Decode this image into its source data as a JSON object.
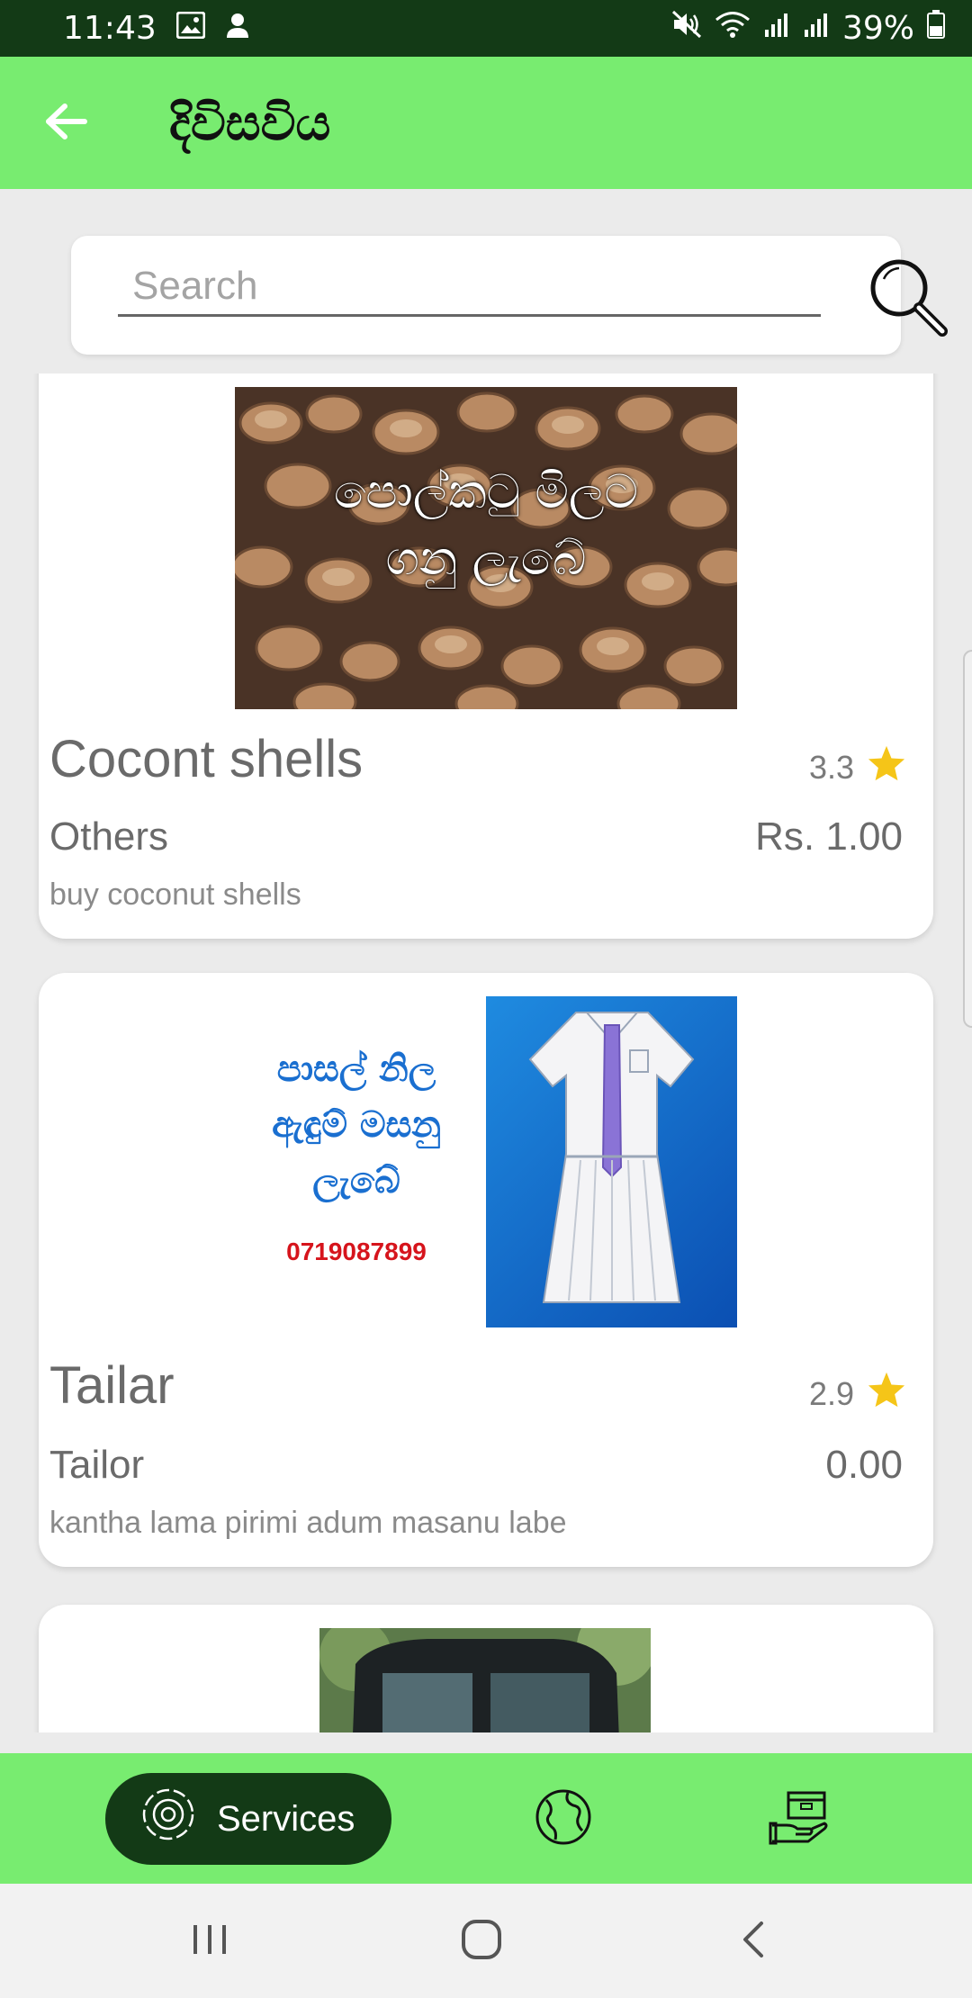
{
  "status_bar": {
    "time": "11:43",
    "battery": "39%",
    "icons": [
      "image-icon",
      "person-icon",
      "mute-icon",
      "wifi-icon",
      "signal-icon",
      "signal-icon",
      "battery-icon"
    ]
  },
  "app_bar": {
    "title": "දිවිසවිය",
    "back_icon": "arrow-left-icon"
  },
  "search": {
    "placeholder": "Search",
    "value": "",
    "icon": "magnifier-icon"
  },
  "listings": [
    {
      "title": "Cocont shells",
      "rating": "3.3",
      "category": "Others",
      "price": "Rs. 1.00",
      "description": "buy coconut shells",
      "image_text_line1": "පොල්කටු මිලට",
      "image_text_line2": "ගනු ලැබේ"
    },
    {
      "title": "Tailar",
      "rating": "2.9",
      "category": "Tailor",
      "price": "0.00",
      "description": "kantha lama pirimi adum masanu labe",
      "image_text_line1": "පාසල් නිල",
      "image_text_line2": "ඇඳුම් මසනු",
      "image_text_line3": "ලැබේ",
      "image_phone": "0719087899"
    },
    {
      "image_alt": "three-wheeler"
    }
  ],
  "bottom_nav": {
    "services_label": "Services",
    "items": [
      "services-gear-icon",
      "globe-icon",
      "box-hand-icon"
    ]
  },
  "colors": {
    "accent_green": "#78ec70",
    "dark_green": "#133a16",
    "star_yellow": "#f5c518",
    "phone_red": "#d6141c",
    "uniform_blue": "#1a6fd0"
  }
}
